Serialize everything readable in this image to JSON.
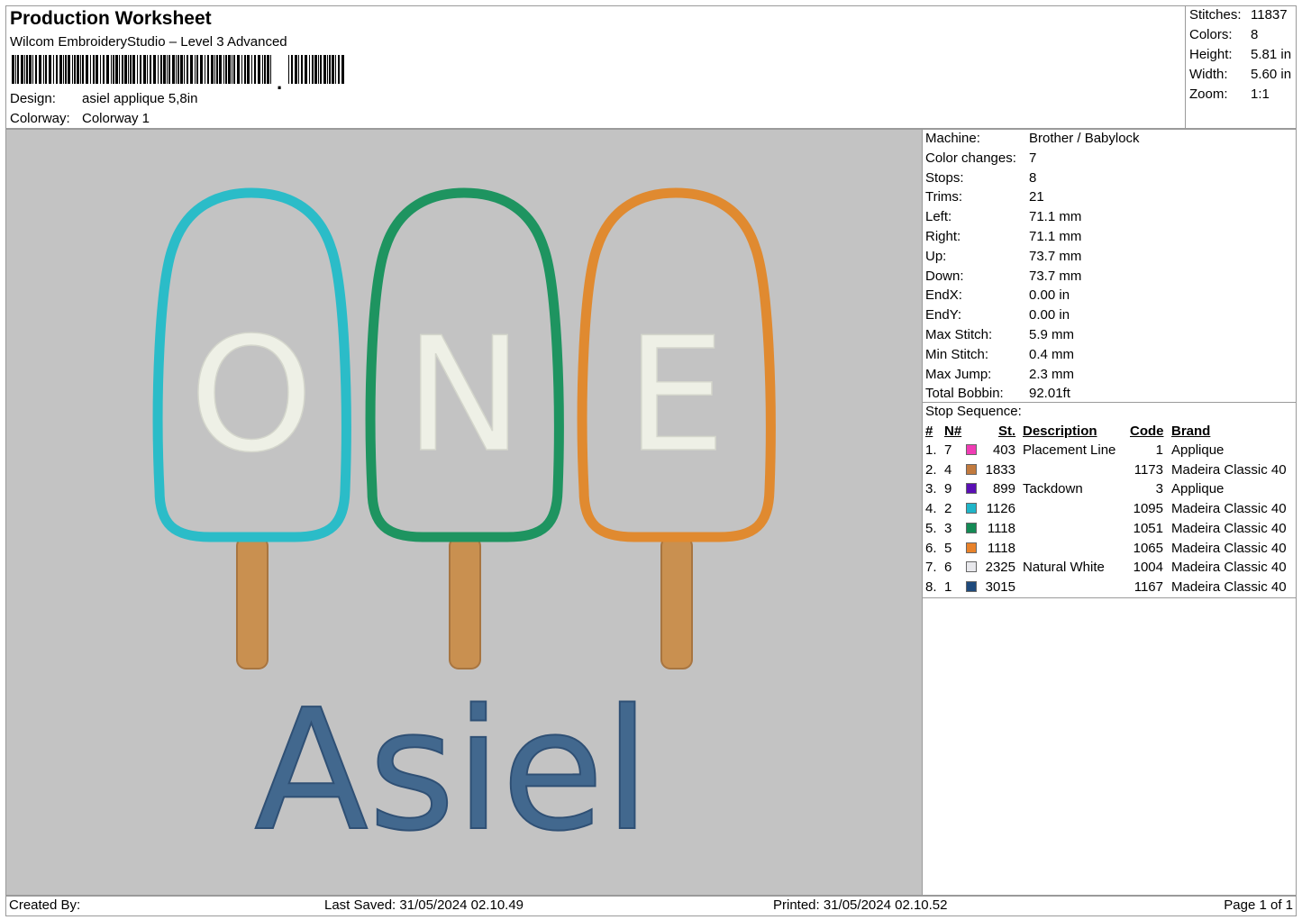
{
  "header": {
    "title": "Production Worksheet",
    "subtitle": "Wilcom EmbroideryStudio – Level 3 Advanced",
    "design_label": "Design:",
    "design_value": "asiel applique 5,8in",
    "colorway_label": "Colorway:",
    "colorway_value": "Colorway 1"
  },
  "stats": [
    {
      "label": "Stitches:",
      "value": "11837"
    },
    {
      "label": "Colors:",
      "value": "8"
    },
    {
      "label": "Height:",
      "value": "5.81 in"
    },
    {
      "label": "Width:",
      "value": "5.60 in"
    },
    {
      "label": "Zoom:",
      "value": "1:1"
    }
  ],
  "machine_info": [
    {
      "label": "Machine:",
      "value": "Brother / Babylock"
    },
    {
      "label": "Color changes:",
      "value": "7"
    },
    {
      "label": "Stops:",
      "value": "8"
    },
    {
      "label": "Trims:",
      "value": "21"
    },
    {
      "label": "Left:",
      "value": "71.1 mm"
    },
    {
      "label": "Right:",
      "value": "71.1 mm"
    },
    {
      "label": "Up:",
      "value": "73.7 mm"
    },
    {
      "label": "Down:",
      "value": "73.7 mm"
    },
    {
      "label": "EndX:",
      "value": "0.00 in"
    },
    {
      "label": "EndY:",
      "value": "0.00 in"
    },
    {
      "label": "Max Stitch:",
      "value": "5.9 mm"
    },
    {
      "label": "Min Stitch:",
      "value": "0.4 mm"
    },
    {
      "label": "Max Jump:",
      "value": "2.3 mm"
    },
    {
      "label": "Total Bobbin:",
      "value": "92.01ft"
    }
  ],
  "stop_sequence": {
    "title": "Stop Sequence:",
    "headers": {
      "num": "#",
      "n": "N#",
      "st": "St.",
      "description": "Description",
      "code": "Code",
      "brand": "Brand"
    },
    "rows": [
      {
        "num": "1.",
        "n": "7",
        "color": "#f03cb4",
        "st": "403",
        "description": "Placement Line",
        "code": "1",
        "brand": "Applique"
      },
      {
        "num": "2.",
        "n": "4",
        "color": "#c27a3e",
        "st": "1833",
        "description": "",
        "code": "1173",
        "brand": "Madeira Classic 40"
      },
      {
        "num": "3.",
        "n": "9",
        "color": "#5a0fb4",
        "st": "899",
        "description": "Tackdown",
        "code": "3",
        "brand": "Applique"
      },
      {
        "num": "4.",
        "n": "2",
        "color": "#1fb5c8",
        "st": "1126",
        "description": "",
        "code": "1095",
        "brand": "Madeira Classic 40"
      },
      {
        "num": "5.",
        "n": "3",
        "color": "#148a55",
        "st": "1118",
        "description": "",
        "code": "1051",
        "brand": "Madeira Classic 40"
      },
      {
        "num": "6.",
        "n": "5",
        "color": "#e8822a",
        "st": "1118",
        "description": "",
        "code": "1065",
        "brand": "Madeira Classic 40"
      },
      {
        "num": "7.",
        "n": "6",
        "color": "#e8e8ec",
        "st": "2325",
        "description": "Natural White",
        "code": "1004",
        "brand": "Madeira Classic 40"
      },
      {
        "num": "8.",
        "n": "1",
        "color": "#1e4a7c",
        "st": "3015",
        "description": "",
        "code": "1167",
        "brand": "Madeira Classic 40"
      }
    ]
  },
  "design": {
    "letters": [
      "O",
      "N",
      "E"
    ],
    "name": "Asiel",
    "colors": {
      "teal": "#2bbcc8",
      "green": "#1e9460",
      "orange": "#e08a30",
      "stick": "#c99050",
      "letter": "#eef0e6",
      "name": "#42688e",
      "background": "#c3c3c3"
    }
  },
  "footer": {
    "created_by": "Created By:",
    "last_saved": "Last Saved: 31/05/2024 02.10.49",
    "printed": "Printed: 31/05/2024 02.10.52",
    "page": "Page 1 of 1"
  }
}
